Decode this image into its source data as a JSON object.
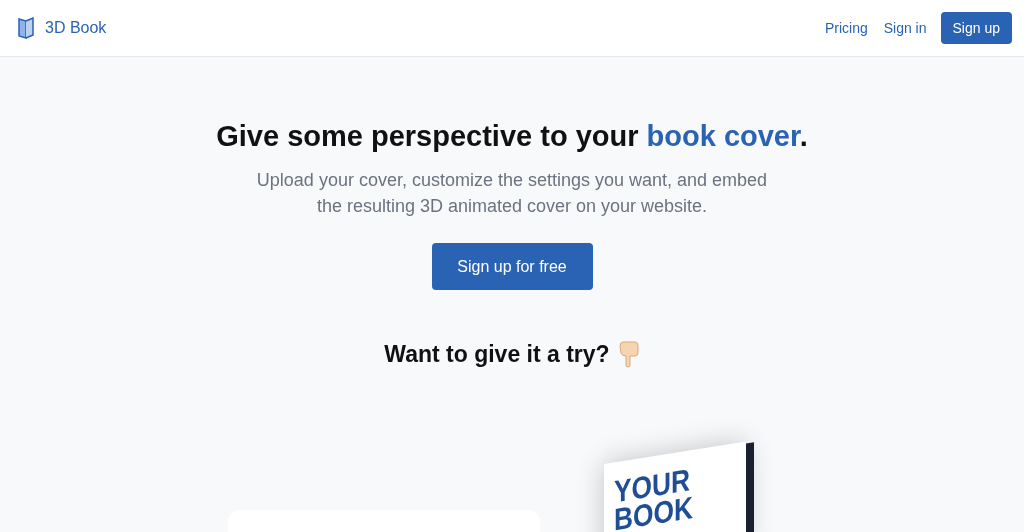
{
  "header": {
    "brand": "3D Book",
    "nav": [
      {
        "label": "Pricing",
        "kind": "link"
      },
      {
        "label": "Sign in",
        "kind": "link"
      },
      {
        "label": "Sign up",
        "kind": "button"
      }
    ]
  },
  "hero": {
    "title_start": "Give some perspective to your ",
    "title_highlight": "book cover",
    "title_end": ".",
    "subtitle": "Upload your cover, customize the settings you want, and embed the resulting 3D animated cover on your website.",
    "cta": "Sign up for free"
  },
  "demo": {
    "heading": "Want to give it a try?",
    "cover_lines": [
      "YOUR",
      "BOOK"
    ]
  }
}
